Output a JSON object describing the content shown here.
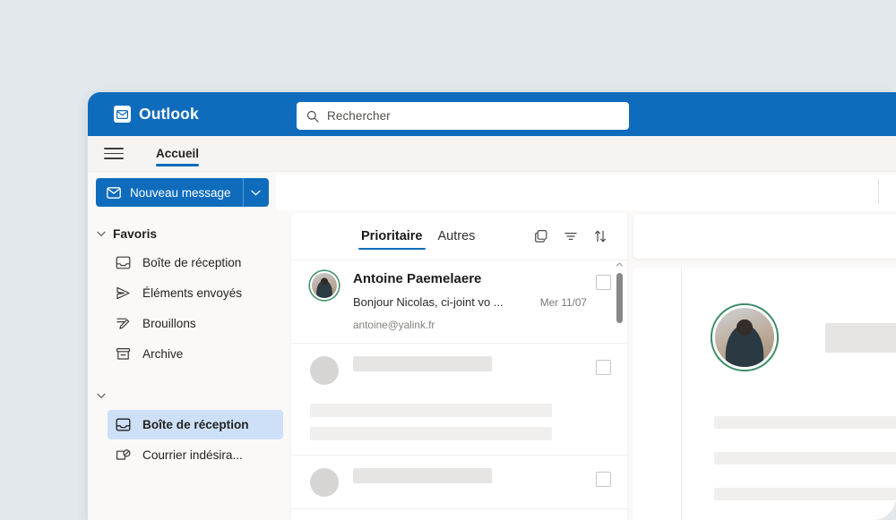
{
  "window": {
    "brand_name": "Outlook",
    "brand_icon": "envelope-icon"
  },
  "search": {
    "placeholder": "Rechercher",
    "icon": "search-icon"
  },
  "ribbon": {
    "menu_icon": "hamburger-icon",
    "tabs": [
      {
        "label": "Accueil",
        "active": true
      }
    ]
  },
  "commandbar": {
    "new_message_label": "Nouveau message",
    "new_message_icon": "envelope-icon",
    "caret_icon": "chevron-down-icon"
  },
  "sidebar": {
    "favorites": {
      "label": "Favoris",
      "chevron_icon": "chevron-down-icon",
      "items": [
        {
          "label": "Boîte de réception",
          "icon": "inbox-icon"
        },
        {
          "label": "Éléments envoyés",
          "icon": "send-icon"
        },
        {
          "label": "Brouillons",
          "icon": "draft-pencil-icon"
        },
        {
          "label": "Archive",
          "icon": "archive-icon"
        }
      ]
    },
    "account": {
      "chevron_icon": "chevron-down-icon",
      "items": [
        {
          "label": "Boîte de réception",
          "icon": "inbox-icon",
          "selected": true
        },
        {
          "label": "Courrier indésira...",
          "icon": "junk-mail-icon",
          "selected": false
        }
      ]
    }
  },
  "message_list": {
    "pivots": [
      {
        "label": "Prioritaire",
        "active": true
      },
      {
        "label": "Autres",
        "active": false
      }
    ],
    "tools": [
      {
        "name": "conversation-view-icon"
      },
      {
        "name": "filter-icon"
      },
      {
        "name": "sort-icon"
      }
    ],
    "messages": [
      {
        "sender": "Antoine Paemelaere",
        "preview": "Bonjour Nicolas, ci-joint vo ...",
        "date": "Mer 11/07",
        "email": "antoine@yalink.fr",
        "has_avatar_photo": true,
        "selected": true
      },
      {
        "sender": "",
        "preview": "",
        "date": "",
        "email": "",
        "has_avatar_photo": false,
        "selected": false
      },
      {
        "sender": "",
        "preview": "",
        "date": "",
        "email": "",
        "has_avatar_photo": false,
        "selected": false
      }
    ],
    "scrollbar": {
      "up_arrow_icon": "chevron-up-icon"
    }
  },
  "reading_pane": {
    "avatar_icon": "contact-photo-avatar",
    "placeholder_blocks": 4
  },
  "colors": {
    "brand_blue": "#0f6cbd",
    "page_background": "#e2e8ec",
    "app_background": "#faf9f8",
    "selected_item": "#cde0f7",
    "skeleton_dark": "#e6e5e4",
    "skeleton_light": "#f0efee",
    "presence_green": "#3c8f6d"
  }
}
